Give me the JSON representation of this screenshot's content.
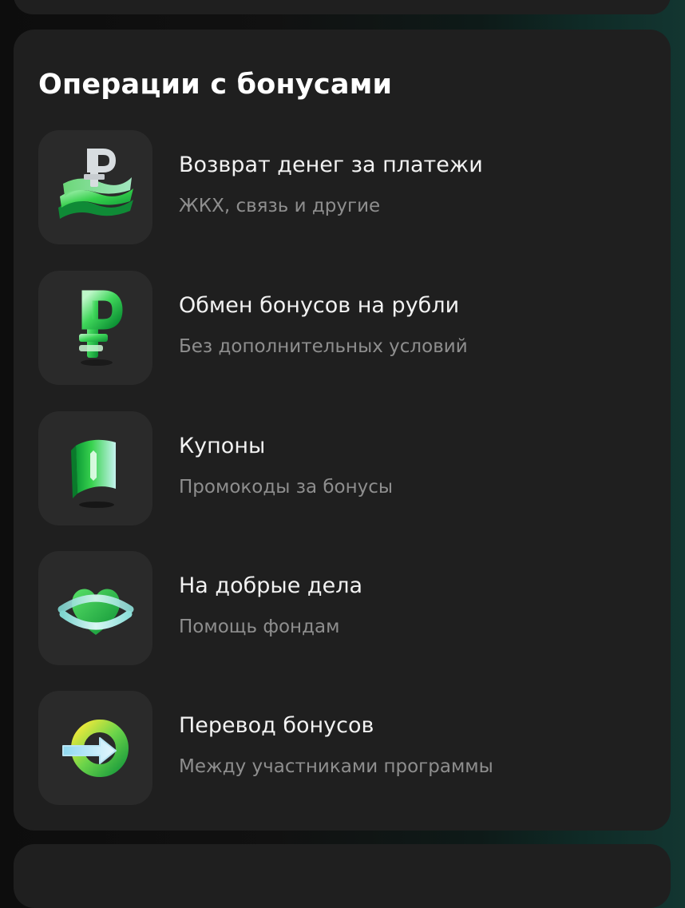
{
  "section": {
    "title": "Операции с бонусами",
    "items": [
      {
        "title": "Возврат денег за платежи",
        "subtitle": "ЖКХ, связь и другие",
        "icon": "ruble-stack-icon"
      },
      {
        "title": "Обмен бонусов на рубли",
        "subtitle": "Без дополнительных условий",
        "icon": "ruble-sign-icon"
      },
      {
        "title": "Купоны",
        "subtitle": "Промокоды за бонусы",
        "icon": "coupon-icon"
      },
      {
        "title": "На добрые дела",
        "subtitle": "Помощь фондам",
        "icon": "heart-ring-icon"
      },
      {
        "title": "Перевод бонусов",
        "subtitle": "Между участниками программы",
        "icon": "transfer-arrow-icon"
      }
    ]
  },
  "colors": {
    "card": "#1f1f1f",
    "tile": "#2a2a2a",
    "accent_green": "#2ecc40",
    "text_primary": "#f2f2f2",
    "text_secondary": "#8e8e8e"
  }
}
